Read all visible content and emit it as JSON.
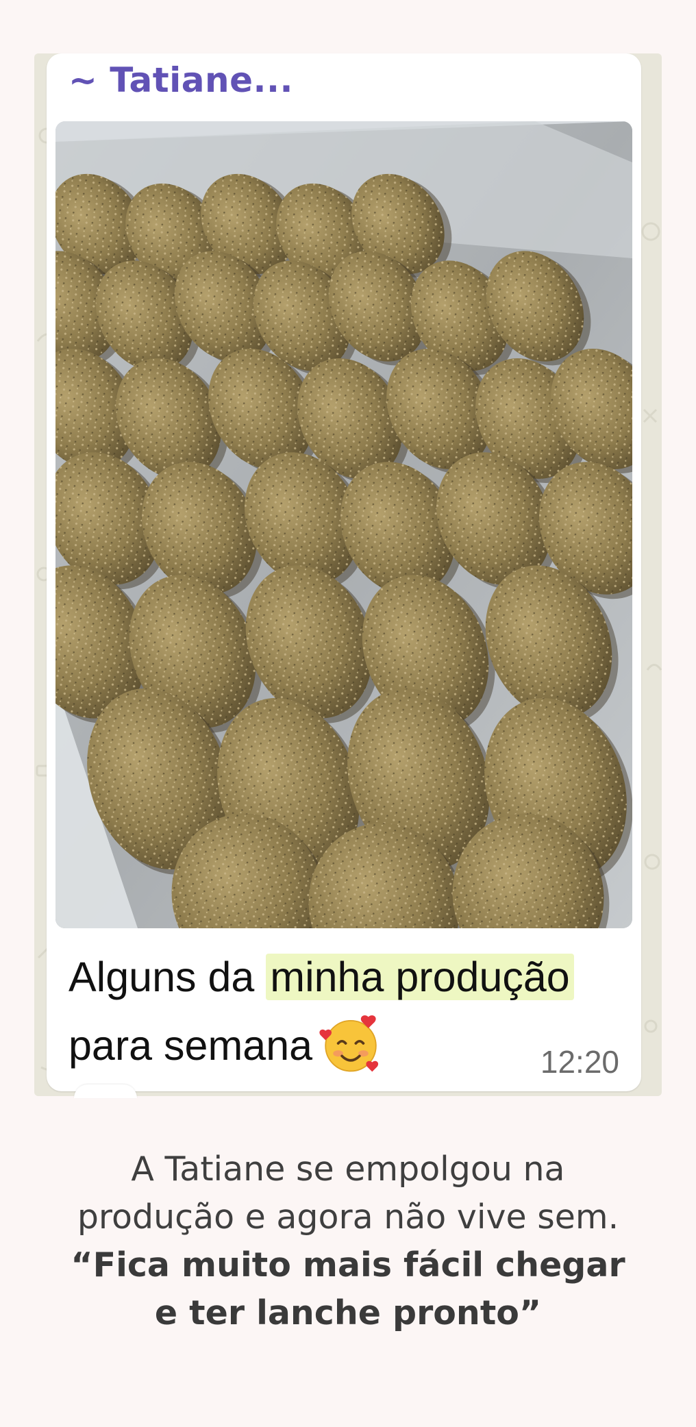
{
  "chat": {
    "sender_name": "~ Tatiane...",
    "photo_alt": "Bandeja com salgados empanados",
    "caption_before": "Alguns da ",
    "caption_highlight": "minha produção",
    "caption_line2": "para semana",
    "emoji_name": "smiling-face-with-hearts-emoji",
    "time": "12:20",
    "colors": {
      "sender": "#6152b5",
      "highlight": "#eef7c2",
      "chat_background": "#e8e6da",
      "bubble": "#ffffff"
    }
  },
  "testimonial": {
    "text": "A Tatiane se empolgou na produção e agora não vive sem.",
    "quote": "“Fica muito mais fácil chegar e ter lanche pronto”"
  },
  "page": {
    "background": "#fcf6f5"
  }
}
